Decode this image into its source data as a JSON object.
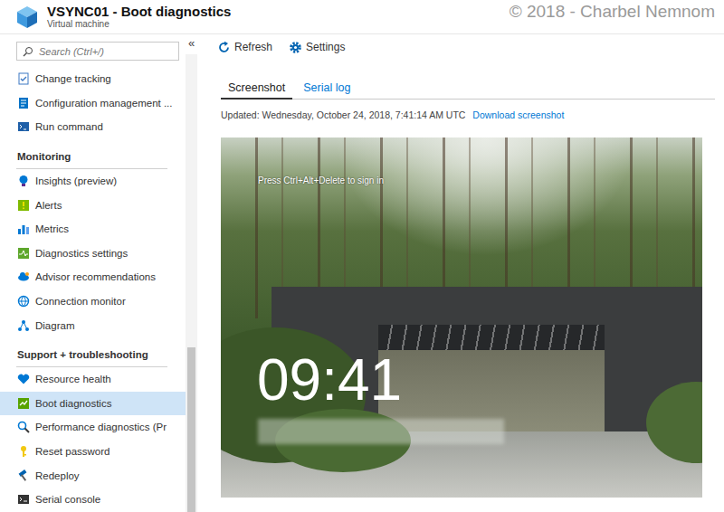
{
  "window": {
    "title": "VSYNC01 - Boot diagnostics",
    "subtitle": "Virtual machine"
  },
  "watermark": "© 2018 - Charbel Nemnom",
  "sidebar": {
    "search": {
      "placeholder": "Search (Ctrl+/)"
    },
    "collapse": "«",
    "items": [
      {
        "label": "Change tracking",
        "selected": false
      },
      {
        "label": "Configuration management ...",
        "selected": false
      },
      {
        "label": "Run command",
        "selected": false
      }
    ],
    "sections": [
      {
        "title": "Monitoring",
        "items": [
          {
            "label": "Insights (preview)",
            "selected": false
          },
          {
            "label": "Alerts",
            "selected": false
          },
          {
            "label": "Metrics",
            "selected": false
          },
          {
            "label": "Diagnostics settings",
            "selected": false
          },
          {
            "label": "Advisor recommendations",
            "selected": false
          },
          {
            "label": "Connection monitor",
            "selected": false
          },
          {
            "label": "Diagram",
            "selected": false
          }
        ]
      },
      {
        "title": "Support + troubleshooting",
        "items": [
          {
            "label": "Resource health",
            "selected": false
          },
          {
            "label": "Boot diagnostics",
            "selected": true
          },
          {
            "label": "Performance diagnostics (Pr",
            "selected": false
          },
          {
            "label": "Reset password",
            "selected": false
          },
          {
            "label": "Redeploy",
            "selected": false
          },
          {
            "label": "Serial console",
            "selected": false
          }
        ]
      }
    ],
    "scrollbar": {
      "thumb_start": 0.64,
      "thumb_size": 0.36
    }
  },
  "toolbar": [
    {
      "label": "Refresh",
      "kind": "refresh"
    },
    {
      "label": "Settings",
      "kind": "settings"
    }
  ],
  "tabs": [
    {
      "label": "Screenshot",
      "selected": true
    },
    {
      "label": "Serial log",
      "selected": false
    }
  ],
  "updated": "Updated: Wednesday, October 24, 2018, 7:41:14 AM UTC",
  "download_link": "Download screenshot",
  "vm_screen": {
    "hint": "Press Ctrl+Alt+Delete to sign in",
    "clock": "09:41"
  }
}
